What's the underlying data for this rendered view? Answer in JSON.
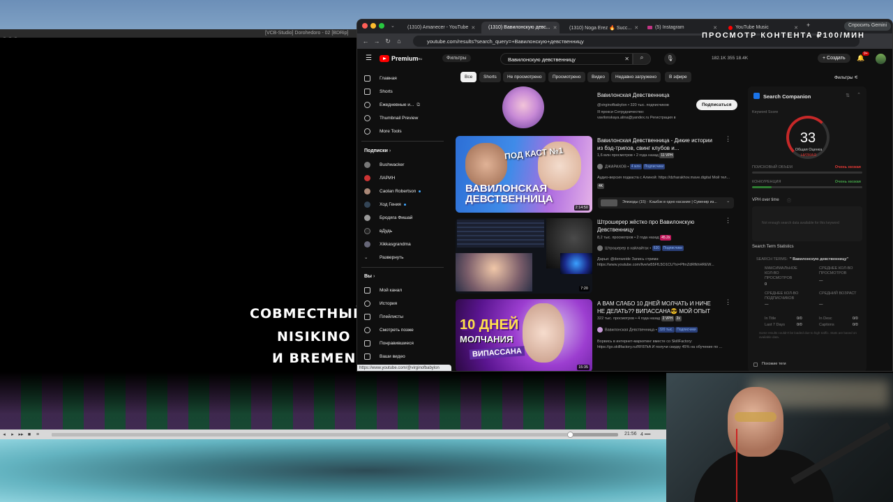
{
  "player": {
    "title": "[VCB-Studio] Dorohedoro - 02 [BDRip]",
    "subtitle_lines": [
      "СОВМЕСТНЫЙ П",
      "NISIKINO & ",
      "И BREMEN B"
    ],
    "time": "21:56",
    "volume": "4",
    "progress": 0.915
  },
  "browser": {
    "tabs": [
      {
        "label": "(1310) Amanecer - YouTube"
      },
      {
        "label": "(1310) Вавилонскую девс..."
      },
      {
        "label": "(1310) Noga Erez 🔥 Succ..."
      },
      {
        "label": "(5) Instagram"
      },
      {
        "label": "YouTube Music"
      }
    ],
    "new_tab": "+",
    "gemini": "Спросить Gemini",
    "url": "youtube.com/results?search_query=+Вавилонскую+девственницу",
    "hover_url": "https://www.youtube.com/@virginofbabylon"
  },
  "overlay": {
    "text": "ПРОСМОТР КОНТЕНТА ₽100/МИН"
  },
  "youtube": {
    "logo": "Premium",
    "logo_region": "RU",
    "filters_button": "Фильтры",
    "search_value": "Вавилонскую девственницу",
    "stats": "182.1K   355   18.4K",
    "create": "Создать",
    "notif_badge": "9+",
    "sidebar": {
      "main": [
        "Главная",
        "Shorts",
        "Ежедневные и...",
        "Thumbnail Preview",
        "More Tools"
      ],
      "subs_title": "Подписки",
      "subs": [
        "Bushwacker",
        "ЛАРИН",
        "Caolan Robertson",
        "Ход Гения",
        "Бродяга Фишай",
        "вДудь",
        "Xikkasgrandma",
        "Развернуть"
      ],
      "you_title": "Вы",
      "you": [
        "Мой канал",
        "История",
        "Плейлисты",
        "Смотреть позже",
        "Понравившиеся",
        "Ваши видео"
      ]
    },
    "chips": [
      "Все",
      "Shorts",
      "Не просмотрено",
      "Просмотрено",
      "Видео",
      "Недавно загружено",
      "В эфире"
    ],
    "filters_right": "Фильтры",
    "channel": {
      "name": "Вавилонская Девственница",
      "handle": "@virginofbabylon • 320 тыс. подписчиков",
      "desc1": "Я прокси Сотрудничество:",
      "desc2": "vavilonskaya.alina@yandex.ru Регистрация в",
      "subscribe": "Подписаться"
    },
    "videos": [
      {
        "title": "Вавилонская Девственница - Дикие истории из бэд-трипов, свинг клубов и...",
        "views": "1,6 млн просмотров • 2 года назад",
        "vph": "11 VPH",
        "channel": "ДЖАРАХОВ",
        "subs": "4 млн",
        "subs_suffix": "Подписчики",
        "desc": "Аудио-версия подкаста с Алиной: https://dzharakhov.mave.digital Мой тел...",
        "badge": "4K",
        "duration": "2:14:50",
        "thumb_top": "ПОД КАСТ №1",
        "thumb_bottom": "ВАВИЛОНСКАЯ ДЕВСТВЕННИЦА",
        "episodes": "Эпизоды (15)",
        "episodes_desc": "Кэшбэк в одно касание | Сувенир из..."
      },
      {
        "title": "Штрошерер жёстко про Вавилонскую Девственницу",
        "views": "8,2 тыс. просмотров • 2 года назад",
        "vph": "45.2x",
        "channel": "Штрошерер в хайлайтах",
        "subs": "630",
        "subs_suffix": "Подписчики",
        "desc": "Дарьи: @denweide Запись стрима:",
        "desc2": "https://www.youtube.com/live/w55FfL5O1CU?si=PfmZdRfkhHREW...",
        "duration": "7:20"
      },
      {
        "title": "А ВАМ СЛАБО 10 ДНЕЙ МОЛЧАТЬ И НИЧЕ НЕ ДЕЛАТЬ?? ВИПАССАНА😎 МОЙ ОПЫТ",
        "views": "322 тыс. просмотров • 4 года назад",
        "vph": "2 VPH",
        "vph2": "2x",
        "channel": "Вавилонская Девственница",
        "subs": "320 тыс.",
        "subs_suffix": "Подписчики",
        "desc": "Ворвись в интернет-маркетинг вместе со SkillFactory:",
        "desc2": "https://go.skillfactory.ru/RF87kA И получи скидку 45% на обучение по ...",
        "duration": "15:35",
        "thumb_top": "10 ДНЕЙ",
        "thumb_mid": "МОЛЧАНИЯ",
        "thumb_bottom": "ВИПАССАНА"
      }
    ],
    "companion": {
      "title": "Search Companion",
      "keyword_score": "Keyword Score",
      "score": "33",
      "score_label": "Общая Оценка",
      "score_level": "НИЗКАЯ",
      "search_volume": "ПОИСКОВЫЙ ОБЪЕМ",
      "search_volume_val": "Очень низкая",
      "competition": "КОНКУРЕНЦИЯ",
      "competition_val": "Очень низкая",
      "competition_fill": 0.18,
      "vph_title": "VPH over time",
      "vph_note": "Not enough search data available for this keyword",
      "stats_title": "Search Term Statistics",
      "search_terms_label": "SEARCH TERMS:",
      "search_terms_value": "\" Вавилонскую девственницу\"",
      "max_views": "МАКСИМАЛЬНОЕ КОЛ-ВО ПРОСМОТРОВ",
      "max_views_val": "0",
      "avg_views": "СРЕДНЕЕ КОЛ-ВО ПРОСМОТРОВ",
      "avg_views_val": "—",
      "avg_subs": "СРЕДНЕЕ КОЛ-ВО ПОДПИСЧИКОВ",
      "avg_subs_val": "—",
      "avg_age": "СРЕДНИЙ ВОЗРАСТ",
      "avg_age_val": "—",
      "in_title": "In Title",
      "last7": "Last 7 Days",
      "in_desc": "In Desc",
      "captions": "Captions",
      "zero": "0/0",
      "note": "Some results couldn't be loaded due to high traffic. Stats are based on available data.",
      "similar_tags": "Похожие теги"
    }
  }
}
